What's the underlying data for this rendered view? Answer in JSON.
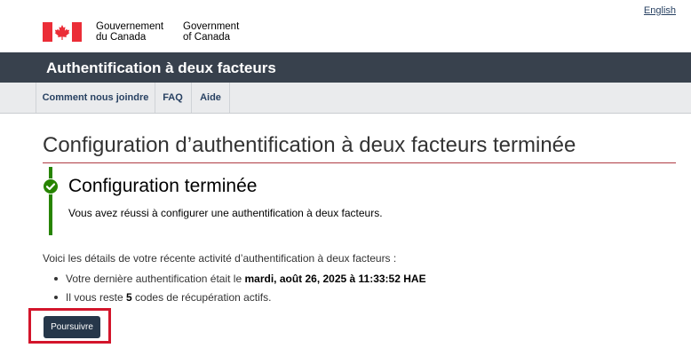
{
  "header": {
    "language_toggle": "English",
    "signature": {
      "fr_line1": "Gouvernement",
      "fr_line2": "du Canada",
      "en_line1": "Government",
      "en_line2": "of Canada",
      "flag_icon": "canada-flag-icon"
    }
  },
  "app_bar": {
    "title": "Authentification à deux facteurs",
    "background": "#38414d"
  },
  "nav": {
    "items": [
      {
        "label": "Comment nous joindre"
      },
      {
        "label": "FAQ"
      },
      {
        "label": "Aide"
      }
    ]
  },
  "main": {
    "page_title": "Configuration d’authentification à deux facteurs terminée",
    "alert": {
      "icon": "check-circle-icon",
      "status_color": "#278400",
      "heading": "Configuration terminée",
      "message": "Vous avez réussi à configurer une authentification à deux facteurs."
    },
    "intro": "Voici les détails de votre récente activité d’authentification à deux facteurs :",
    "details": {
      "last_auth_prefix": "Votre dernière authentification était le ",
      "last_auth_value": "mardi, août 26, 2025 à 11:33:52 HAE",
      "codes_prefix": "Il vous reste ",
      "codes_count": "5",
      "codes_suffix": " codes de récupération actifs."
    },
    "continue_button": "Poursuivre"
  },
  "colors": {
    "accent_rule": "#af3c43",
    "button": "#26374a",
    "highlight": "#d3152b",
    "link": "#284162"
  }
}
